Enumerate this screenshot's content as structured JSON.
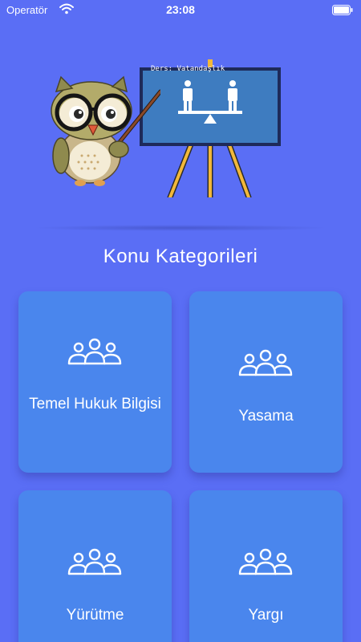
{
  "status_bar": {
    "carrier": "Operatör",
    "time": "23:08"
  },
  "header": {
    "board_text": "Ders: Vatandaşlık"
  },
  "section_title": "Konu Kategorileri",
  "categories": [
    {
      "label": "Temel Hukuk Bilgisi",
      "icon": "group-icon"
    },
    {
      "label": "Yasama",
      "icon": "group-icon"
    },
    {
      "label": "Yürütme",
      "icon": "group-icon"
    },
    {
      "label": "Yargı",
      "icon": "group-icon"
    }
  ],
  "colors": {
    "background": "#5a6ef5",
    "card": "#4a86ed",
    "board": "#3e7cc0",
    "easel": "#f2b83a"
  }
}
